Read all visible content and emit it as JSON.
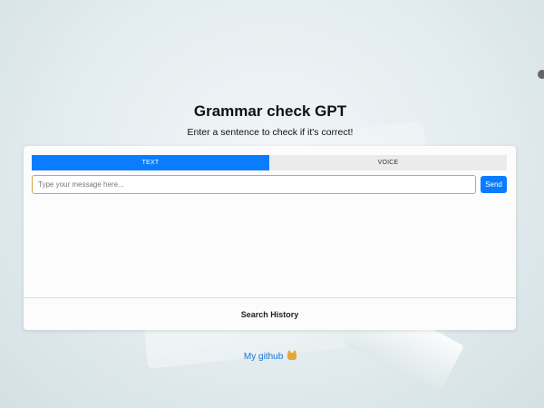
{
  "header": {
    "title": "Grammar check GPT",
    "subtitle": "Enter a sentence to check if it's correct!"
  },
  "tabs": [
    {
      "label": "TEXT",
      "active": true
    },
    {
      "label": "VOICE",
      "active": false
    }
  ],
  "input": {
    "value": "",
    "placeholder": "Type your message here..."
  },
  "send_label": "Send",
  "history_label": "Search History",
  "footer": {
    "link_text": "My github",
    "icon": "cat-face-icon"
  },
  "colors": {
    "accent": "#0a7cff",
    "input_border": "#d4a64a",
    "link": "#1a73d9"
  }
}
